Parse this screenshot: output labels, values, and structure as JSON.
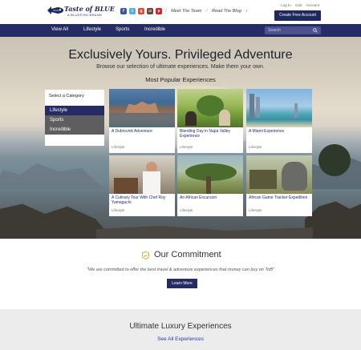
{
  "header": {
    "logo_title": "Taste of BLUE",
    "logo_sub": "A BLUEFISH BRAND",
    "socials": [
      {
        "icon": "facebook-icon",
        "glyph": "f",
        "color": "#3b5998"
      },
      {
        "icon": "twitter-icon",
        "glyph": "t",
        "color": "#55acee"
      },
      {
        "icon": "google-plus-icon",
        "glyph": "g+",
        "color": "#dd4b39"
      },
      {
        "icon": "instagram-icon",
        "glyph": "◘",
        "color": "#6a4a3c"
      },
      {
        "icon": "pinterest-icon",
        "glyph": "p",
        "color": "#cb2027"
      }
    ],
    "meet_team": "Meet The Team",
    "read_blog": "Read The Blog",
    "util": [
      "Log In",
      "Cart",
      "Account"
    ],
    "create_account": "Create Free Account"
  },
  "nav": {
    "items": [
      "View All",
      "Lifestyle",
      "Sports",
      "Incredible"
    ],
    "search_placeholder": "Search"
  },
  "hero": {
    "title": "Exclusively Yours. Privileged Adventure",
    "subtitle": "Browse our selection of ultimate experiences. Make them your own.",
    "popular": "Most Popular Experiences"
  },
  "categories": {
    "heading": "Select a Category",
    "items": [
      "Lifestyle",
      "Sports",
      "Incredible"
    ],
    "active": "Lifestyle"
  },
  "cards": [
    {
      "title": "A Dubrovnik Adventure",
      "tag": "Lifestyle"
    },
    {
      "title": "Blending Day in Napa Valley Experience",
      "tag": "Lifestyle"
    },
    {
      "title": "A Miami Experience",
      "tag": "Lifestyle"
    },
    {
      "title": "A Culinary Tour With Chef Roy Yamaguchi",
      "tag": "Lifestyle"
    },
    {
      "title": "An African Excursion",
      "tag": "Lifestyle"
    },
    {
      "title": "African Game Tracker Expedition",
      "tag": "Lifestyle"
    }
  ],
  "commitment": {
    "title": "Our Commitment",
    "text": "\"We are committed to offer the best travel & adventure experiences that money can buy on ToB\"",
    "button": "Learn More"
  },
  "luxury": {
    "title": "Ultimate Luxury Experiences",
    "link": "See All Experiences"
  },
  "colors": {
    "brand_navy": "#252c63",
    "link_blue": "#1e2a7a"
  }
}
